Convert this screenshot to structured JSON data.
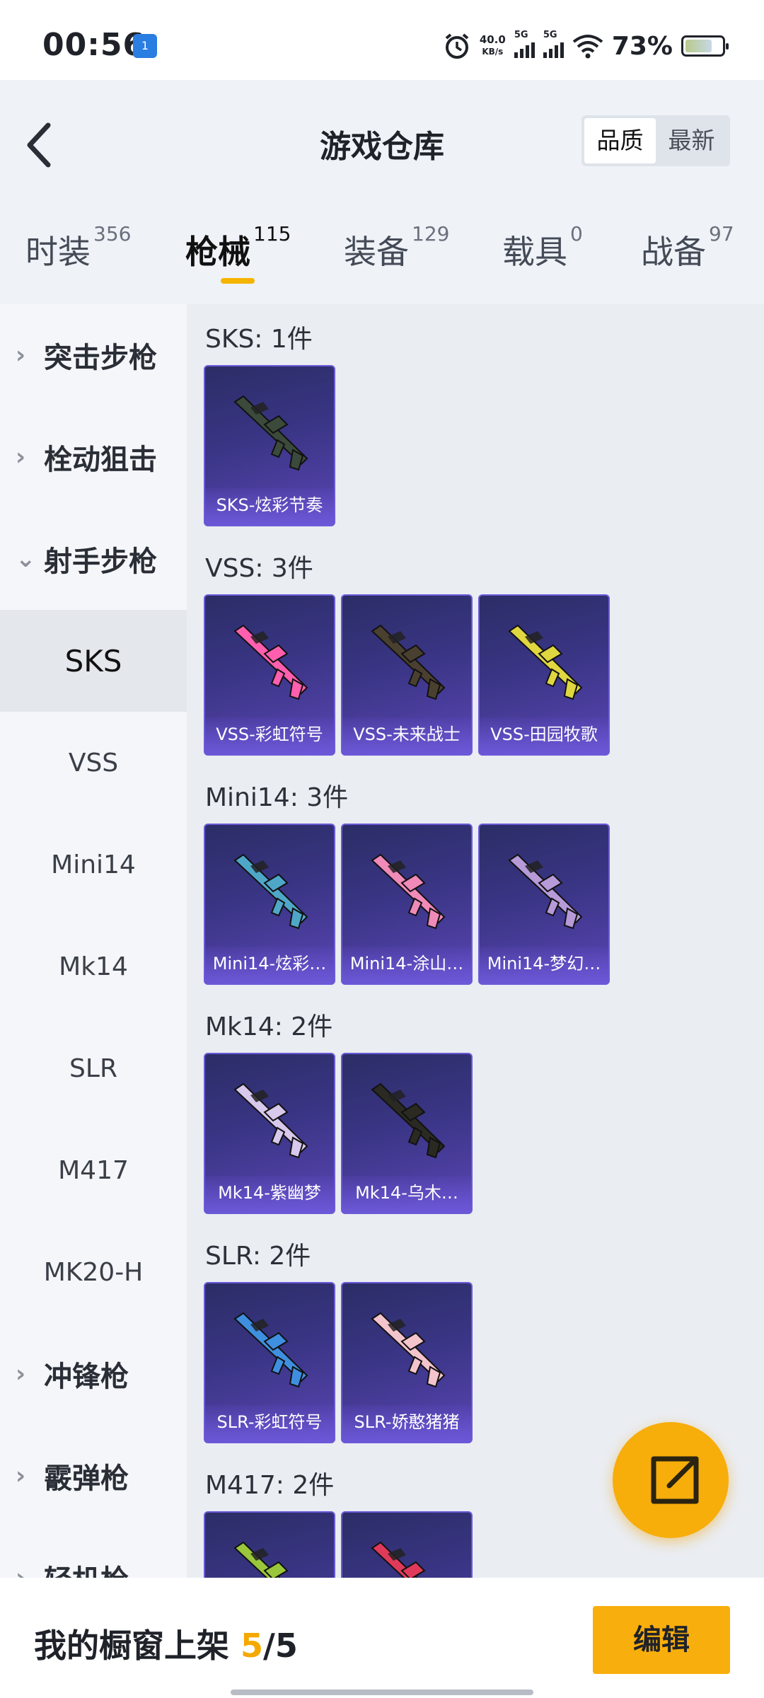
{
  "status_bar": {
    "time": "00:56",
    "notif_badge": "1",
    "net_speed_value": "40.0",
    "net_speed_unit": "KB/s",
    "signal1_tag": "5G",
    "signal2_tag": "5G",
    "battery_pct": "73%",
    "battery_level": 0.73
  },
  "header": {
    "title": "游戏仓库",
    "sort_options": [
      "品质",
      "最新"
    ],
    "sort_selected": "品质"
  },
  "tabs": [
    {
      "label": "时装",
      "count": "356"
    },
    {
      "label": "枪械",
      "count": "115",
      "active": true
    },
    {
      "label": "装备",
      "count": "129"
    },
    {
      "label": "载具",
      "count": "0"
    },
    {
      "label": "战备",
      "count": "97"
    }
  ],
  "sidebar": {
    "items": [
      {
        "label": "突击步枪",
        "kind": "category",
        "expanded": false
      },
      {
        "label": "栓动狙击",
        "kind": "category",
        "expanded": false
      },
      {
        "label": "射手步枪",
        "kind": "category",
        "expanded": true
      },
      {
        "label": "SKS",
        "kind": "sub",
        "active": true
      },
      {
        "label": "VSS",
        "kind": "sub"
      },
      {
        "label": "Mini14",
        "kind": "sub"
      },
      {
        "label": "Mk14",
        "kind": "sub"
      },
      {
        "label": "SLR",
        "kind": "sub"
      },
      {
        "label": "M417",
        "kind": "sub"
      },
      {
        "label": "MK20-H",
        "kind": "sub"
      },
      {
        "label": "冲锋枪",
        "kind": "category",
        "expanded": false
      },
      {
        "label": "霰弹枪",
        "kind": "category",
        "expanded": false
      },
      {
        "label": "轻机枪",
        "kind": "category",
        "expanded": false
      }
    ]
  },
  "sections": [
    {
      "title": "SKS: 1件",
      "items": [
        {
          "name": "SKS-炫彩节奏",
          "color": "#3b4a3a"
        }
      ]
    },
    {
      "title": "VSS: 3件",
      "items": [
        {
          "name": "VSS-彩虹符号",
          "color": "#ff5fae"
        },
        {
          "name": "VSS-未来战士",
          "color": "#4a4030"
        },
        {
          "name": "VSS-田园牧歌",
          "color": "#e0d640"
        }
      ]
    },
    {
      "title": "Mini14: 3件",
      "items": [
        {
          "name": "Mini14-炫彩…",
          "color": "#4fa7c8"
        },
        {
          "name": "Mini14-涂山…",
          "color": "#f08ab8"
        },
        {
          "name": "Mini14-梦幻…",
          "color": "#b79ad8"
        }
      ]
    },
    {
      "title": "Mk14: 2件",
      "items": [
        {
          "name": "Mk14-紫幽梦",
          "color": "#d8c8ec"
        },
        {
          "name": "Mk14-乌木…",
          "color": "#2a2a22"
        }
      ]
    },
    {
      "title": "SLR: 2件",
      "items": [
        {
          "name": "SLR-彩虹符号",
          "color": "#3f8fe0"
        },
        {
          "name": "SLR-娇憨猪猪",
          "color": "#f4c4cc"
        }
      ]
    },
    {
      "title": "M417: 2件",
      "items": [
        {
          "name": "",
          "color": "#9ac63c"
        },
        {
          "name": "",
          "color": "#e03a5a"
        }
      ]
    }
  ],
  "bottom_bar": {
    "showcase_prefix": "我的橱窗上架 ",
    "showcase_count": "5",
    "showcase_total": "/5",
    "edit_label": "编辑"
  },
  "colors": {
    "accent": "#f8ae0c",
    "card_bg": "#3a3585"
  }
}
